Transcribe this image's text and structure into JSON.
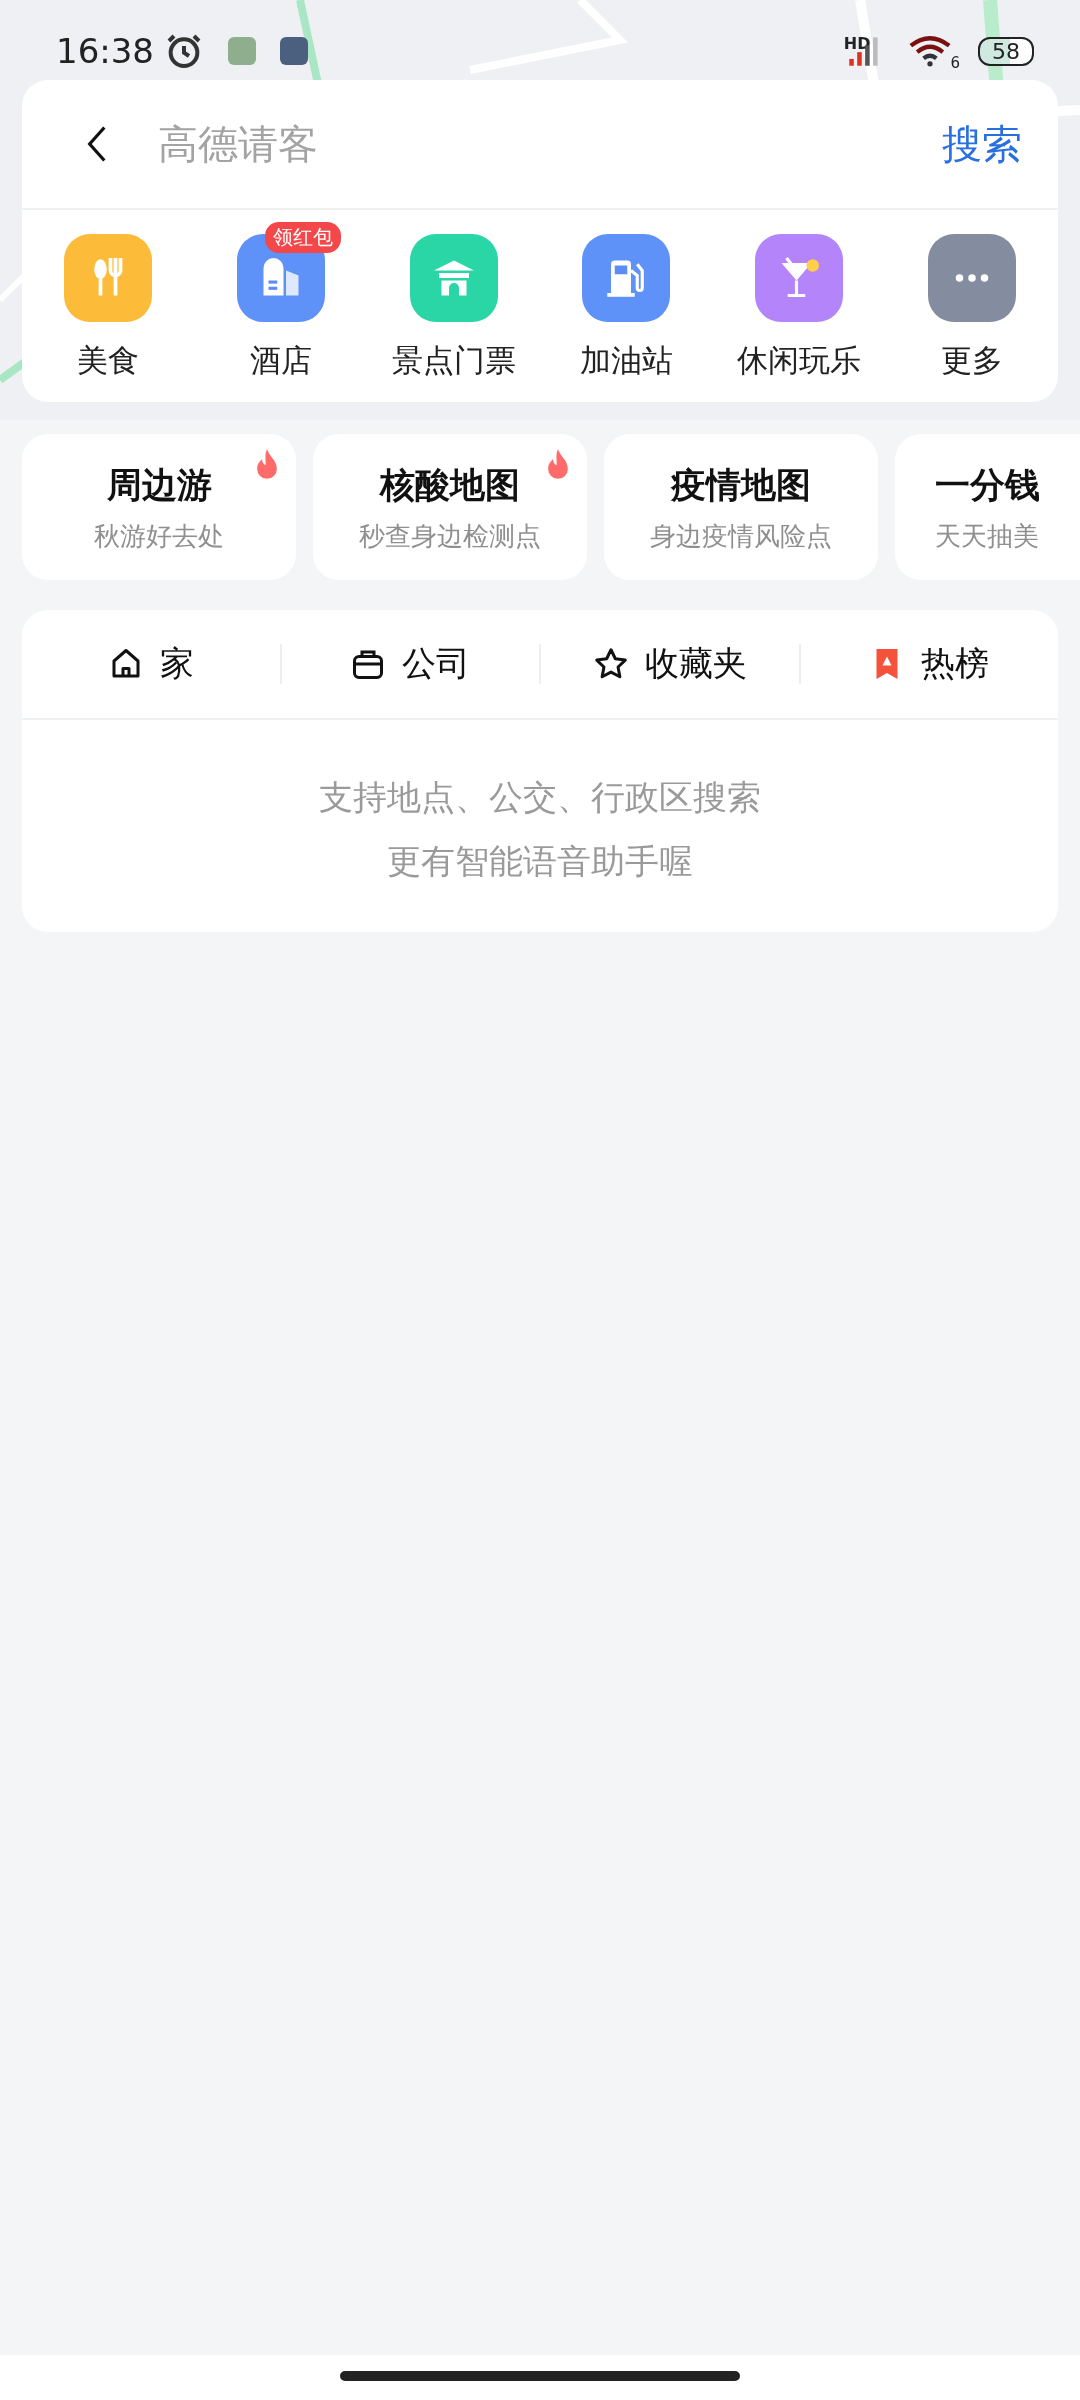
{
  "status_bar": {
    "time": "16:38",
    "network_label": "HD",
    "wifi_label": "6",
    "battery": "58"
  },
  "search": {
    "placeholder": "高德请客",
    "button": "搜索"
  },
  "shortcuts": [
    {
      "label": "美食"
    },
    {
      "label": "酒店",
      "badge": "领红包"
    },
    {
      "label": "景点门票"
    },
    {
      "label": "加油站"
    },
    {
      "label": "休闲玩乐"
    },
    {
      "label": "更多"
    }
  ],
  "quick_cards": [
    {
      "title": "周边游",
      "subtitle": "秋游好去处",
      "hot": true
    },
    {
      "title": "核酸地图",
      "subtitle": "秒查身边检测点",
      "hot": true
    },
    {
      "title": "疫情地图",
      "subtitle": "身边疫情风险点",
      "hot": false
    },
    {
      "title": "一分钱",
      "subtitle": "天天抽美",
      "hot": false
    }
  ],
  "tabs": [
    {
      "label": "家"
    },
    {
      "label": "公司"
    },
    {
      "label": "收藏夹"
    },
    {
      "label": "热榜"
    }
  ],
  "hint": [
    "支持地点、公交、行政区搜索",
    "更有智能语音助手喔"
  ]
}
